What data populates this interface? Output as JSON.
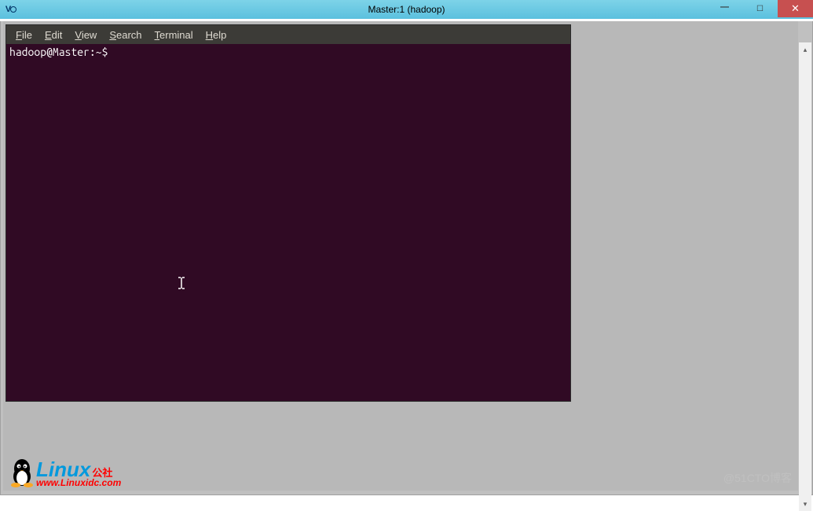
{
  "titlebar": {
    "app_icon_text": "V",
    "title": "Master:1 (hadoop)"
  },
  "window_controls": {
    "minimize": "—",
    "maximize": "☐",
    "close": "✕"
  },
  "terminal": {
    "menu": {
      "file": "File",
      "edit": "Edit",
      "view": "View",
      "search": "Search",
      "terminal": "Terminal",
      "help": "Help"
    },
    "prompt": "hadoop@Master:~$"
  },
  "scrollbar": {
    "up_arrow": "▴",
    "down_arrow": "▾"
  },
  "watermarks": {
    "logo_linux": "Linux",
    "logo_gongshe": "公社",
    "logo_url": "www.Linuxidc.com",
    "right_text": "@51CTO博客"
  }
}
